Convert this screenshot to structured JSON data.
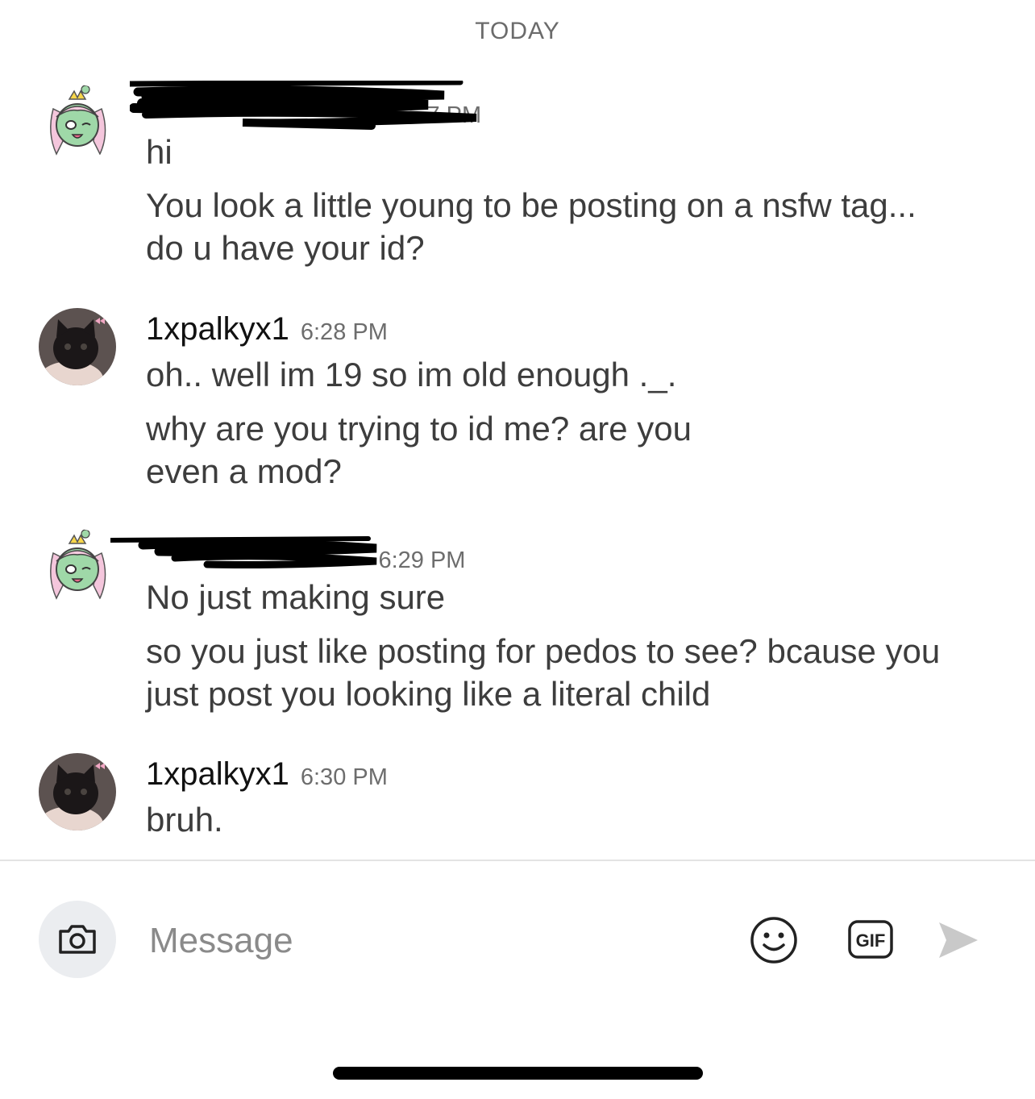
{
  "date_divider": "TODAY",
  "messages": [
    {
      "sender": "",
      "time": "7 PM",
      "redacted": true,
      "avatar": "anime-girl-avatar",
      "lines": [
        "hi",
        "You look a little young to be posting on a nsfw tag... do u have your id?"
      ]
    },
    {
      "sender": "1xpalkyx1",
      "time": "6:28 PM",
      "redacted": false,
      "avatar": "black-cat-avatar",
      "lines": [
        "oh.. well im 19 so im old enough ._.",
        "why are you trying to id me? are you even a mod?"
      ]
    },
    {
      "sender": "",
      "time": "6:29 PM",
      "redacted": true,
      "avatar": "anime-girl-avatar",
      "lines": [
        "No just making sure",
        "so you just like posting for pedos to see? bcause you just post you looking like a literal child"
      ]
    },
    {
      "sender": "1xpalkyx1",
      "time": "6:30 PM",
      "redacted": false,
      "avatar": "black-cat-avatar",
      "lines": [
        "bruh."
      ]
    }
  ],
  "composer": {
    "placeholder": "Message",
    "camera_icon": "camera-icon",
    "emoji_icon": "emoji-icon",
    "gif_label": "GIF",
    "send_icon": "send-icon"
  }
}
